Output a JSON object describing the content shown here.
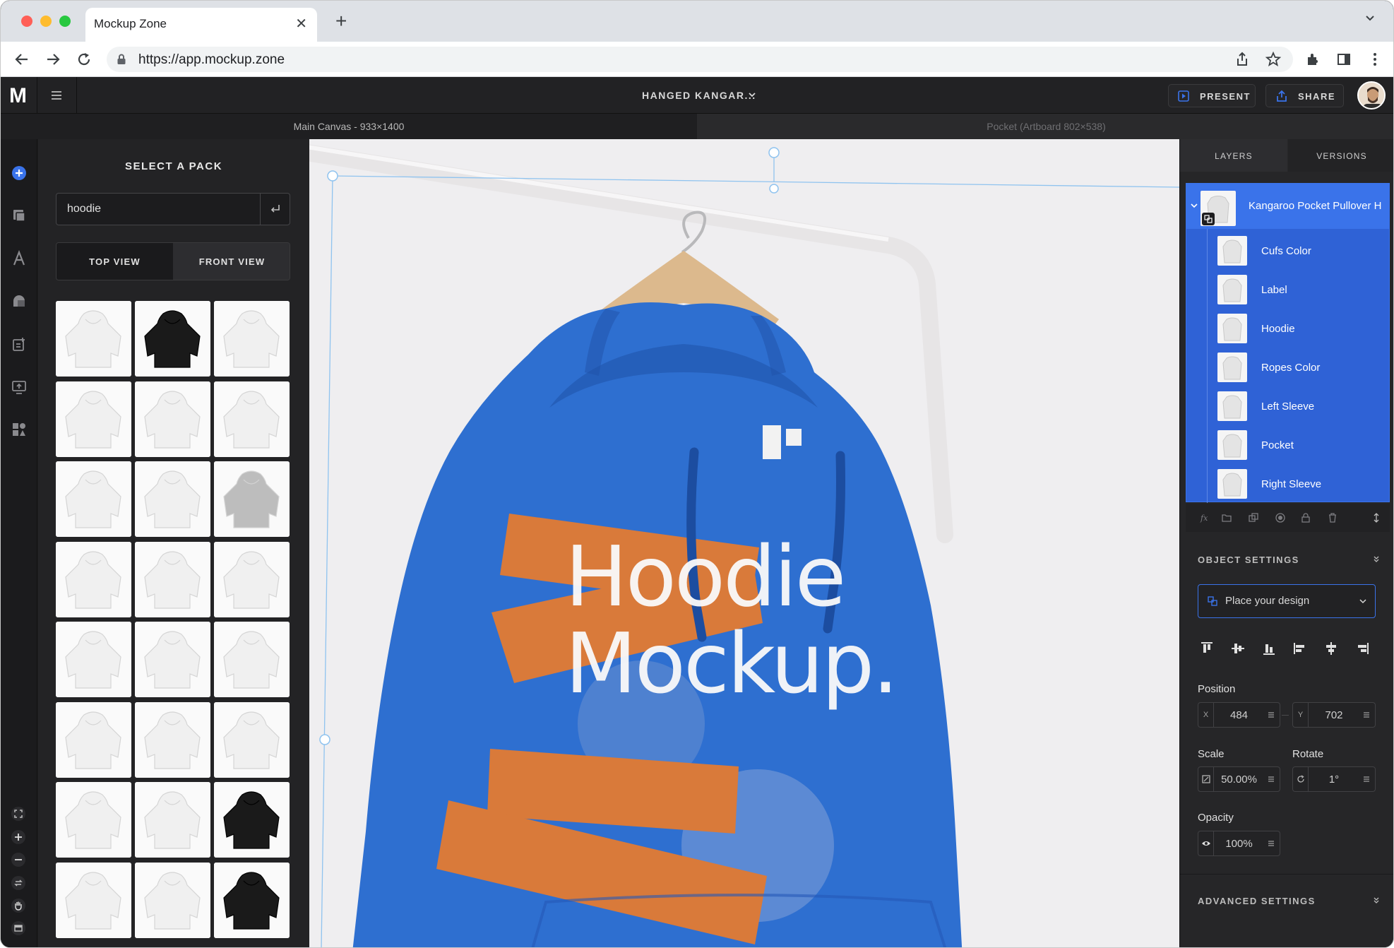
{
  "browser": {
    "tab_title": "Mockup Zone",
    "url": "https://app.mockup.zone"
  },
  "header": {
    "logo": "M",
    "document_title": "HANGED KANGAR...",
    "present_label": "PRESENT",
    "share_label": "SHARE"
  },
  "canvas_tabs": {
    "main": "Main Canvas - 933×1400",
    "pocket": "Pocket (Artboard 802×538)"
  },
  "pack_panel": {
    "title": "SELECT A PACK",
    "search_value": "hoodie",
    "view_options": [
      "TOP VIEW",
      "FRONT VIEW"
    ],
    "thumbnails": [
      "white",
      "black",
      "white",
      "white",
      "white",
      "white",
      "white",
      "white",
      "grey",
      "white",
      "white",
      "white",
      "white",
      "white",
      "white",
      "white",
      "white",
      "white",
      "white",
      "white",
      "black",
      "white",
      "white",
      "black"
    ]
  },
  "canvas": {
    "headline_line1": "Hoodie",
    "headline_line2": "Mockup.",
    "hoodie_color": "#2e6fd0",
    "accent_color": "#d97a3a"
  },
  "right_panel": {
    "tabs": [
      "LAYERS",
      "VERSIONS"
    ],
    "root_layer": "Kangaroo Pocket Pullover H",
    "layers": [
      "Cufs Color",
      "Label",
      "Hoodie",
      "Ropes Color",
      "Left Sleeve",
      "Pocket",
      "Right Sleeve"
    ],
    "object_settings_title": "OBJECT SETTINGS",
    "place_design_label": "Place your design",
    "position_label": "Position",
    "position_x_prefix": "X",
    "position_x": "484",
    "position_y_prefix": "Y",
    "position_y": "702",
    "scale_label": "Scale",
    "scale_value": "50.00%",
    "rotate_label": "Rotate",
    "rotate_value": "1°",
    "opacity_label": "Opacity",
    "opacity_value": "100%",
    "advanced_settings_title": "ADVANCED SETTINGS"
  },
  "colors": {
    "accent_blue": "#3a73ea",
    "layer_selected_bg": "#2f62d6"
  }
}
